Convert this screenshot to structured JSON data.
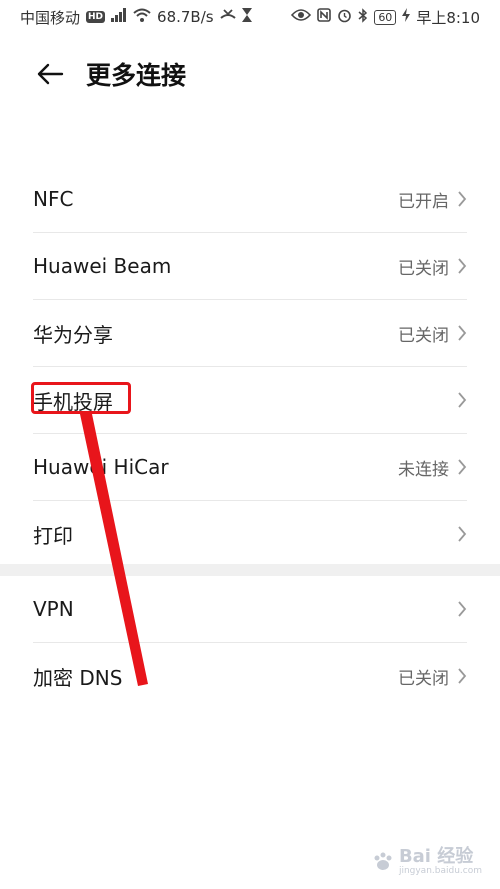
{
  "status_bar": {
    "carrier": "中国移动",
    "hd": "HD",
    "network": "⁴ᴳ",
    "speed": "68.7B/s",
    "battery": "60",
    "time": "早上8:10"
  },
  "header": {
    "title": "更多连接"
  },
  "settings": {
    "group1": [
      {
        "label": "NFC",
        "value": "已开启"
      },
      {
        "label": "Huawei Beam",
        "value": "已关闭"
      },
      {
        "label": "华为分享",
        "value": "已关闭"
      },
      {
        "label": "手机投屏",
        "value": ""
      },
      {
        "label": "Huawei HiCar",
        "value": "未连接"
      },
      {
        "label": "打印",
        "value": ""
      }
    ],
    "group2": [
      {
        "label": "VPN",
        "value": ""
      },
      {
        "label": "加密 DNS",
        "value": "已关闭"
      }
    ]
  },
  "annotation": {
    "color": "#e8151b"
  },
  "watermark": {
    "text": "Bai 经验",
    "sub": "jingyan.baidu.com"
  }
}
